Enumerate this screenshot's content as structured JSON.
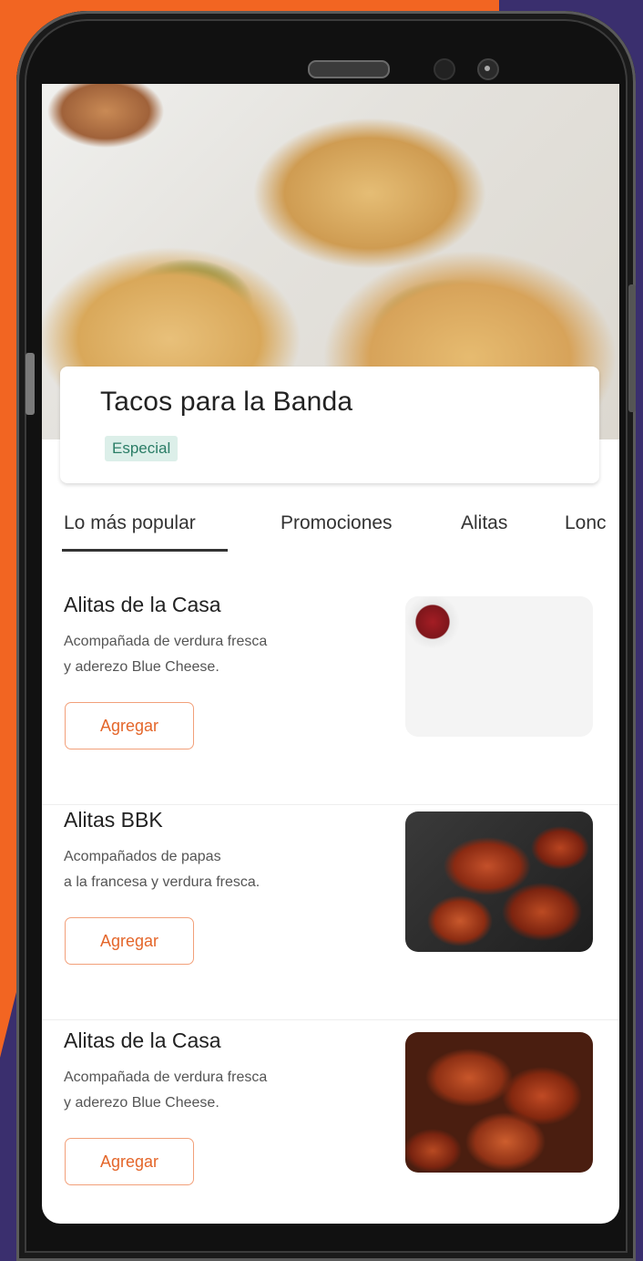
{
  "restaurant": {
    "name": "Tacos para la Banda",
    "badge": "Especial"
  },
  "tabs": [
    {
      "label": "Lo más popular",
      "active": true
    },
    {
      "label": "Promociones",
      "active": false
    },
    {
      "label": "Alitas",
      "active": false
    },
    {
      "label": "Lonc",
      "active": false
    }
  ],
  "menu_items": [
    {
      "title": "Alitas de la Casa",
      "description": "Acompañada de verdura fresca\ny aderezo Blue Cheese.",
      "button": "Agregar"
    },
    {
      "title": "Alitas BBK",
      "description": "Acompañados de papas\na la francesa y verdura fresca.",
      "button": "Agregar"
    },
    {
      "title": "Alitas de la Casa",
      "description": "Acompañada de verdura fresca\ny aderezo Blue Cheese.",
      "button": "Agregar"
    }
  ],
  "colors": {
    "accent": "#e4662a",
    "badge_bg": "#dcefe9",
    "badge_text": "#2a7d66",
    "background_orange": "#f26522",
    "background_purple": "#3a2f6e"
  }
}
